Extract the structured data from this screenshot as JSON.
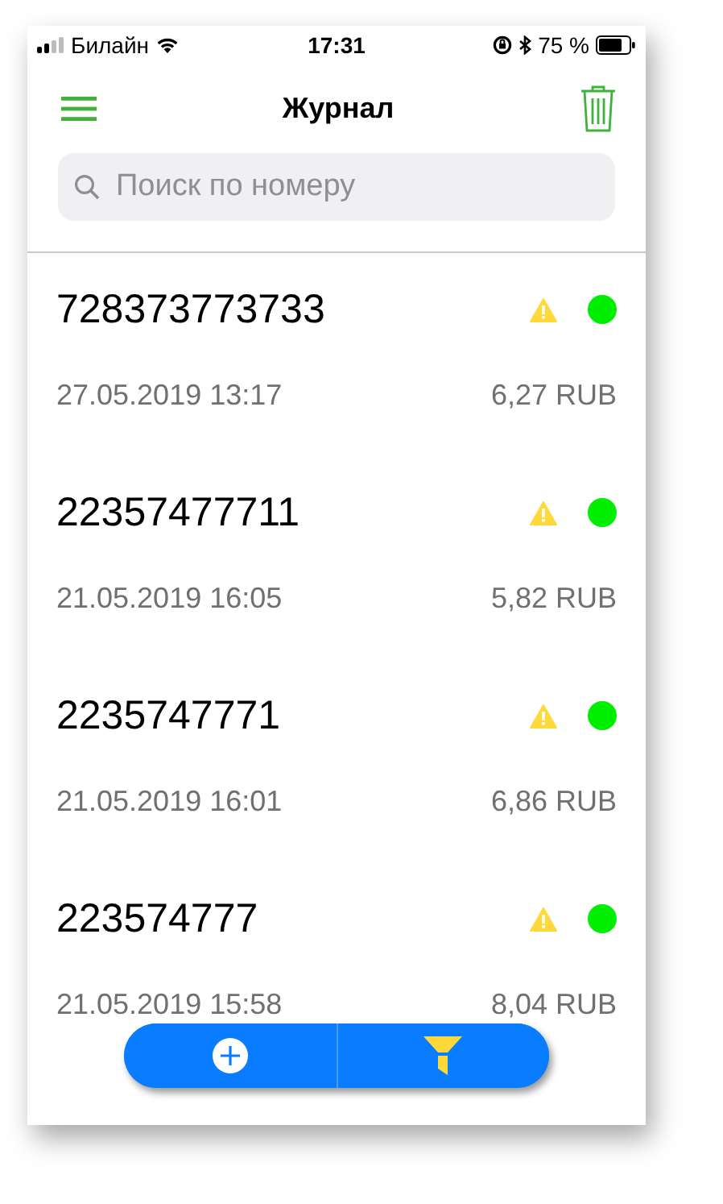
{
  "status_bar": {
    "carrier": "Билайн",
    "time": "17:31",
    "battery": "75 %"
  },
  "nav": {
    "title": "Журнал"
  },
  "search": {
    "placeholder": "Поиск по номеру"
  },
  "entries": [
    {
      "number": "728373773733",
      "date": "27.05.2019 13:17",
      "amount": "6,27 RUB"
    },
    {
      "number": "22357477711",
      "date": "21.05.2019 16:05",
      "amount": "5,82 RUB"
    },
    {
      "number": "2235747771",
      "date": "21.05.2019 16:01",
      "amount": "6,86 RUB"
    },
    {
      "number": "223574777",
      "date": "21.05.2019 15:58",
      "amount": "8,04 RUB"
    }
  ]
}
